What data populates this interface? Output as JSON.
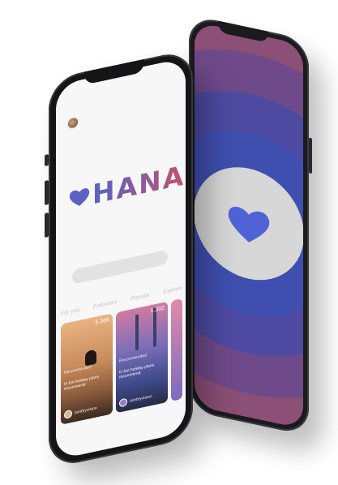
{
  "splash": {
    "colors": {
      "outer": "#8c4f76",
      "ring2": "#6f4a8a",
      "ring3": "#4e4aa2",
      "ring4": "#3f4fb0",
      "center": "#d7d7d7",
      "heart": "#4f63d6"
    },
    "icon": "heart-icon"
  },
  "app": {
    "logo": {
      "text": "HANA",
      "icon": "heart-icon",
      "gradient": [
        "#5a62c4",
        "#c4526d"
      ]
    },
    "tabs": [
      "For you",
      "Followers",
      "Popular",
      "Explore"
    ],
    "cards": [
      {
        "count": "5.306",
        "tag": "Recommended",
        "title": "In fun holiday plans recommend",
        "user": "iamthyvision",
        "theme": "desert"
      },
      {
        "count": "1.302",
        "tag": "Recommended",
        "title": "In fun holiday plans recommend",
        "user": "iamthyvision",
        "theme": "city"
      }
    ]
  }
}
